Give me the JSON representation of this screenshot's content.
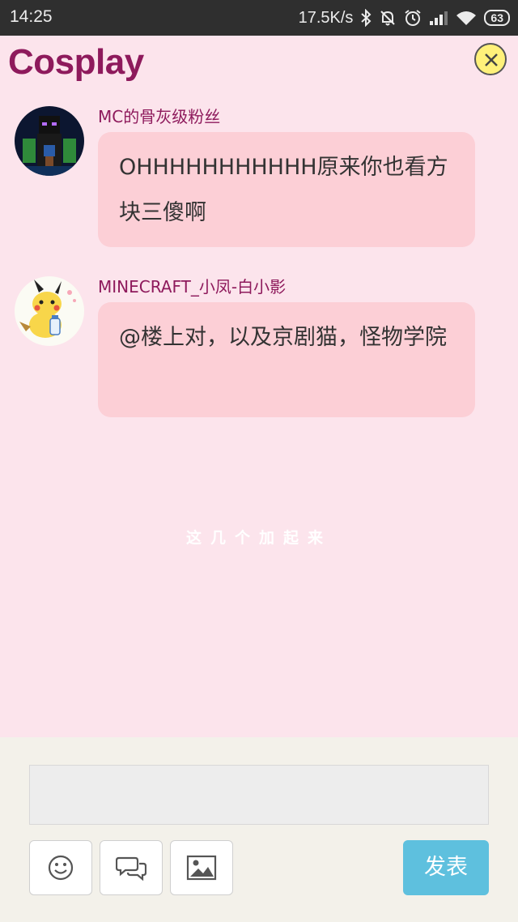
{
  "status_bar": {
    "time": "14:25",
    "network_speed": "17.5K/s",
    "battery": "63",
    "icons": [
      "bluetooth-icon",
      "mute-notification-icon",
      "alarm-icon",
      "signal-icon",
      "wifi-icon",
      "battery-icon"
    ]
  },
  "header": {
    "title": "Cosplay",
    "close_icon": "close-icon",
    "close_button_color": "#fff17a"
  },
  "comments": [
    {
      "username": "MC的骨灰级粉丝",
      "text": "OHHHHHHHHHHH原来你也看方块三傻啊",
      "avatar_icon": "avatar-dark-figure"
    },
    {
      "username": "MINECRAFT_小凤-白小影",
      "text": "@楼上对，以及京剧猫，怪物学院",
      "avatar_icon": "avatar-pikachu"
    }
  ],
  "overlay_caption": "这几个加起来",
  "composer": {
    "input_value": "",
    "tools": [
      {
        "icon": "emoji-icon"
      },
      {
        "icon": "chat-bubbles-icon"
      },
      {
        "icon": "image-icon"
      }
    ],
    "send_label": "发表"
  },
  "colors": {
    "background": "#fce4ec",
    "title": "#8e1a5c",
    "bubble": "#fccfd6",
    "send_button": "#5ec0de",
    "composer_bg": "#f3f1ea"
  }
}
